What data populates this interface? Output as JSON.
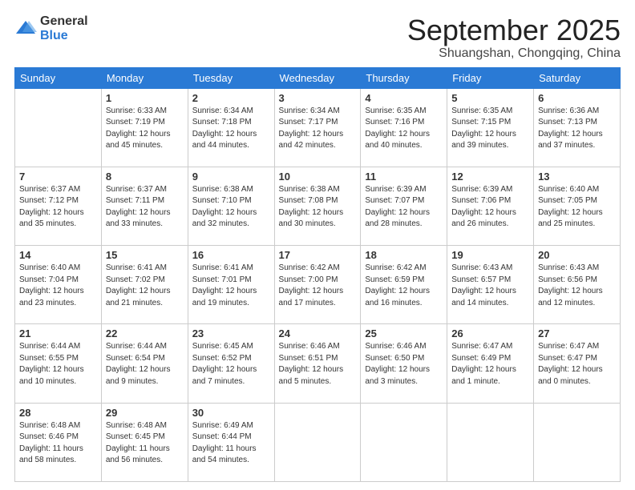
{
  "header": {
    "logo_general": "General",
    "logo_blue": "Blue",
    "month": "September 2025",
    "location": "Shuangshan, Chongqing, China"
  },
  "weekdays": [
    "Sunday",
    "Monday",
    "Tuesday",
    "Wednesday",
    "Thursday",
    "Friday",
    "Saturday"
  ],
  "weeks": [
    [
      {
        "day": "",
        "info": ""
      },
      {
        "day": "1",
        "info": "Sunrise: 6:33 AM\nSunset: 7:19 PM\nDaylight: 12 hours\nand 45 minutes."
      },
      {
        "day": "2",
        "info": "Sunrise: 6:34 AM\nSunset: 7:18 PM\nDaylight: 12 hours\nand 44 minutes."
      },
      {
        "day": "3",
        "info": "Sunrise: 6:34 AM\nSunset: 7:17 PM\nDaylight: 12 hours\nand 42 minutes."
      },
      {
        "day": "4",
        "info": "Sunrise: 6:35 AM\nSunset: 7:16 PM\nDaylight: 12 hours\nand 40 minutes."
      },
      {
        "day": "5",
        "info": "Sunrise: 6:35 AM\nSunset: 7:15 PM\nDaylight: 12 hours\nand 39 minutes."
      },
      {
        "day": "6",
        "info": "Sunrise: 6:36 AM\nSunset: 7:13 PM\nDaylight: 12 hours\nand 37 minutes."
      }
    ],
    [
      {
        "day": "7",
        "info": "Sunrise: 6:37 AM\nSunset: 7:12 PM\nDaylight: 12 hours\nand 35 minutes."
      },
      {
        "day": "8",
        "info": "Sunrise: 6:37 AM\nSunset: 7:11 PM\nDaylight: 12 hours\nand 33 minutes."
      },
      {
        "day": "9",
        "info": "Sunrise: 6:38 AM\nSunset: 7:10 PM\nDaylight: 12 hours\nand 32 minutes."
      },
      {
        "day": "10",
        "info": "Sunrise: 6:38 AM\nSunset: 7:08 PM\nDaylight: 12 hours\nand 30 minutes."
      },
      {
        "day": "11",
        "info": "Sunrise: 6:39 AM\nSunset: 7:07 PM\nDaylight: 12 hours\nand 28 minutes."
      },
      {
        "day": "12",
        "info": "Sunrise: 6:39 AM\nSunset: 7:06 PM\nDaylight: 12 hours\nand 26 minutes."
      },
      {
        "day": "13",
        "info": "Sunrise: 6:40 AM\nSunset: 7:05 PM\nDaylight: 12 hours\nand 25 minutes."
      }
    ],
    [
      {
        "day": "14",
        "info": "Sunrise: 6:40 AM\nSunset: 7:04 PM\nDaylight: 12 hours\nand 23 minutes."
      },
      {
        "day": "15",
        "info": "Sunrise: 6:41 AM\nSunset: 7:02 PM\nDaylight: 12 hours\nand 21 minutes."
      },
      {
        "day": "16",
        "info": "Sunrise: 6:41 AM\nSunset: 7:01 PM\nDaylight: 12 hours\nand 19 minutes."
      },
      {
        "day": "17",
        "info": "Sunrise: 6:42 AM\nSunset: 7:00 PM\nDaylight: 12 hours\nand 17 minutes."
      },
      {
        "day": "18",
        "info": "Sunrise: 6:42 AM\nSunset: 6:59 PM\nDaylight: 12 hours\nand 16 minutes."
      },
      {
        "day": "19",
        "info": "Sunrise: 6:43 AM\nSunset: 6:57 PM\nDaylight: 12 hours\nand 14 minutes."
      },
      {
        "day": "20",
        "info": "Sunrise: 6:43 AM\nSunset: 6:56 PM\nDaylight: 12 hours\nand 12 minutes."
      }
    ],
    [
      {
        "day": "21",
        "info": "Sunrise: 6:44 AM\nSunset: 6:55 PM\nDaylight: 12 hours\nand 10 minutes."
      },
      {
        "day": "22",
        "info": "Sunrise: 6:44 AM\nSunset: 6:54 PM\nDaylight: 12 hours\nand 9 minutes."
      },
      {
        "day": "23",
        "info": "Sunrise: 6:45 AM\nSunset: 6:52 PM\nDaylight: 12 hours\nand 7 minutes."
      },
      {
        "day": "24",
        "info": "Sunrise: 6:46 AM\nSunset: 6:51 PM\nDaylight: 12 hours\nand 5 minutes."
      },
      {
        "day": "25",
        "info": "Sunrise: 6:46 AM\nSunset: 6:50 PM\nDaylight: 12 hours\nand 3 minutes."
      },
      {
        "day": "26",
        "info": "Sunrise: 6:47 AM\nSunset: 6:49 PM\nDaylight: 12 hours\nand 1 minute."
      },
      {
        "day": "27",
        "info": "Sunrise: 6:47 AM\nSunset: 6:47 PM\nDaylight: 12 hours\nand 0 minutes."
      }
    ],
    [
      {
        "day": "28",
        "info": "Sunrise: 6:48 AM\nSunset: 6:46 PM\nDaylight: 11 hours\nand 58 minutes."
      },
      {
        "day": "29",
        "info": "Sunrise: 6:48 AM\nSunset: 6:45 PM\nDaylight: 11 hours\nand 56 minutes."
      },
      {
        "day": "30",
        "info": "Sunrise: 6:49 AM\nSunset: 6:44 PM\nDaylight: 11 hours\nand 54 minutes."
      },
      {
        "day": "",
        "info": ""
      },
      {
        "day": "",
        "info": ""
      },
      {
        "day": "",
        "info": ""
      },
      {
        "day": "",
        "info": ""
      }
    ]
  ]
}
